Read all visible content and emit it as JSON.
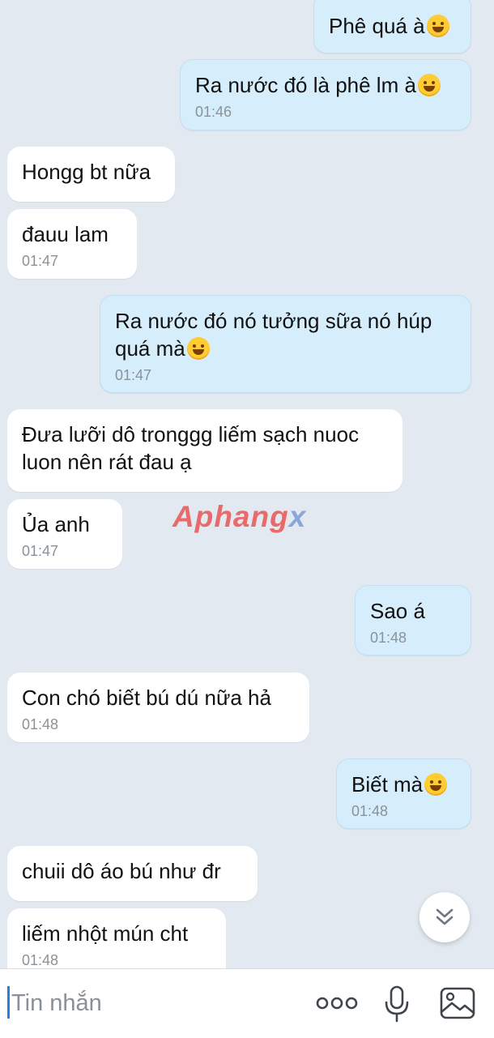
{
  "messages": [
    {
      "side": "out",
      "text": "Phê quá à",
      "emoji": "rolling-on-floor-laughing",
      "time": ""
    },
    {
      "side": "out",
      "text": "Ra nước đó là phê lm à",
      "emoji": "rolling-on-floor-laughing",
      "time": "01:46"
    },
    {
      "side": "in",
      "text": "Hongg bt nữa",
      "time": ""
    },
    {
      "side": "in",
      "text": "đauu lam",
      "time": "01:47"
    },
    {
      "side": "out",
      "text": "Ra nước đó nó tưởng sữa nó húp quá mà",
      "emoji": "drooling-face",
      "time": "01:47"
    },
    {
      "side": "in",
      "text": "Đưa lưỡi dô tronggg liếm sạch nuoc luon nên rát đau ạ",
      "time": ""
    },
    {
      "side": "in",
      "text": "Ủa anh",
      "time": "01:47"
    },
    {
      "side": "out",
      "text": "Sao á",
      "time": "01:48"
    },
    {
      "side": "in",
      "text": "Con chó biết bú dú nữa hả",
      "time": "01:48"
    },
    {
      "side": "out",
      "text": "Biết mà",
      "emoji": "rolling-on-floor-laughing",
      "time": "01:48"
    },
    {
      "side": "in",
      "text": "chuii dô áo bú như đr",
      "time": ""
    },
    {
      "side": "in",
      "text": "liếm nhột mún cht",
      "time": "01:48"
    }
  ],
  "watermark": {
    "main": "Aphang",
    "suffix": "x"
  },
  "composer": {
    "placeholder": "Tin nhắn"
  },
  "icons": {
    "scroll_down": "chevron-double-down-icon",
    "more": "more-dots-icon",
    "mic": "microphone-icon",
    "image": "image-icon"
  },
  "colors": {
    "background": "#e2e9f1",
    "incoming": "#ffffff",
    "outgoing": "#d6eefc",
    "accent": "#2b7de1"
  }
}
